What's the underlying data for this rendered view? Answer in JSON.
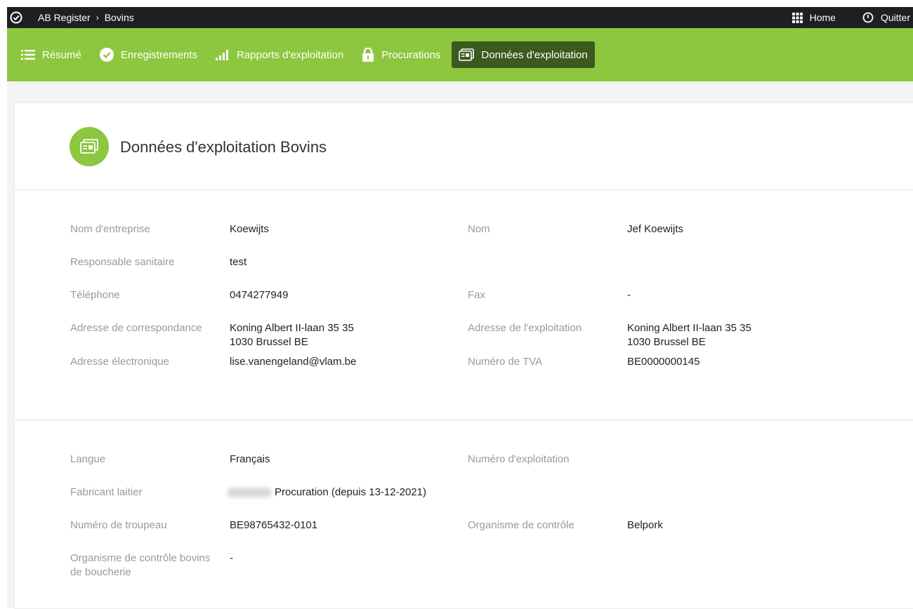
{
  "topbar": {
    "breadcrumb": [
      "AB Register",
      "Bovins"
    ],
    "home_label": "Home",
    "quit_label": "Quitter"
  },
  "nav": {
    "items": [
      {
        "label": "Résumé",
        "icon": "list-icon"
      },
      {
        "label": "Enregistrements",
        "icon": "check-circle-icon"
      },
      {
        "label": "Rapports d'exploitation",
        "icon": "bar-chart-icon"
      },
      {
        "label": "Procurations",
        "icon": "lock-icon"
      },
      {
        "label": "Données d'exploitation",
        "icon": "id-card-icon",
        "active": true
      }
    ]
  },
  "page": {
    "title": "Données d'exploitation Bovins",
    "title_icon": "id-card-icon"
  },
  "details": {
    "company_name_label": "Nom d'entreprise",
    "company_name": "Koewijts",
    "name_label": "Nom",
    "name": "Jef Koewijts",
    "health_label": "Responsable sanitaire",
    "health": "test",
    "phone_label": "Téléphone",
    "phone": "0474277949",
    "fax_label": "Fax",
    "fax": "-",
    "corr_address_label": "Adresse de correspondance",
    "corr_address_line1": "Koning Albert II-laan 35 35",
    "corr_address_line2": "1030 Brussel BE",
    "farm_address_label": "Adresse de l'exploitation",
    "farm_address_line1": "Koning Albert II-laan 35 35",
    "farm_address_line2": "1030 Brussel BE",
    "email_label": "Adresse électronique",
    "email": "lise.vanengeland@vlam.be",
    "vat_label": "Numéro de TVA",
    "vat": "BE0000000145"
  },
  "extra": {
    "language_label": "Langue",
    "language": "Français",
    "farm_number_label": "Numéro d'exploitation",
    "farm_number": "",
    "dairy_label": "Fabricant laitier",
    "dairy_value": "Procuration (depuis 13-12-2021)",
    "herd_label": "Numéro de troupeau",
    "herd": "BE98765432-0101",
    "control_label": "Organisme de contrôle",
    "control": "Belpork",
    "beef_control_label_line1": "Organisme de contrôle bovins",
    "beef_control_label_line2": "de boucherie",
    "beef_control": "-"
  },
  "colors": {
    "nav_green": "#8dc63f",
    "nav_active": "#3d5a1e",
    "topbar": "#1f1f1f"
  }
}
